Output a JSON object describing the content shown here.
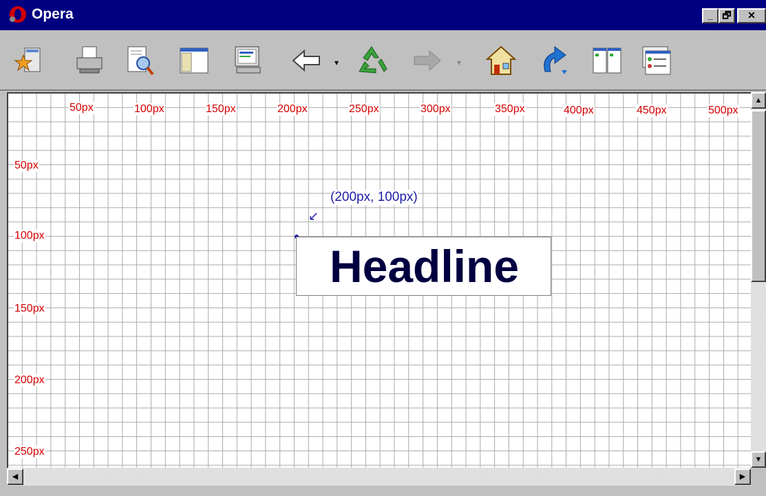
{
  "window": {
    "title": "Opera",
    "minimize_glyph": "_",
    "restore_glyph": "🗗",
    "close_glyph": "✕"
  },
  "toolbar": {
    "buttons": [
      {
        "icon": "bookmark-star-icon"
      },
      {
        "icon": "print-icon"
      },
      {
        "icon": "spellcheck-icon"
      },
      {
        "icon": "panels-icon"
      },
      {
        "icon": "monitor-icon"
      },
      {
        "icon": "back-arrow-icon"
      },
      {
        "icon": "reload-recycle-icon"
      },
      {
        "icon": "forward-arrow-icon"
      },
      {
        "icon": "home-icon"
      },
      {
        "icon": "redirect-arrow-icon"
      },
      {
        "icon": "tile-windows-icon"
      },
      {
        "icon": "window-list-icon"
      }
    ],
    "dropdown_glyph": "▾"
  },
  "content": {
    "x_ruler": [
      "50px",
      "100px",
      "150px",
      "200px",
      "250px",
      "300px",
      "350px",
      "400px",
      "450px",
      "500px"
    ],
    "y_ruler": [
      "50px",
      "100px",
      "150px",
      "200px",
      "250px"
    ],
    "coordinate_label": "(200px, 100px)",
    "arrow_glyph": "↙",
    "headline": "Headline"
  },
  "scrollbars": {
    "up": "▲",
    "down": "▼",
    "left": "◀",
    "right": "▶"
  },
  "colors": {
    "titlebar": "#000080",
    "ruler_text": "#d40000",
    "coord_text": "#1d1da8",
    "headline_text": "#000040"
  }
}
